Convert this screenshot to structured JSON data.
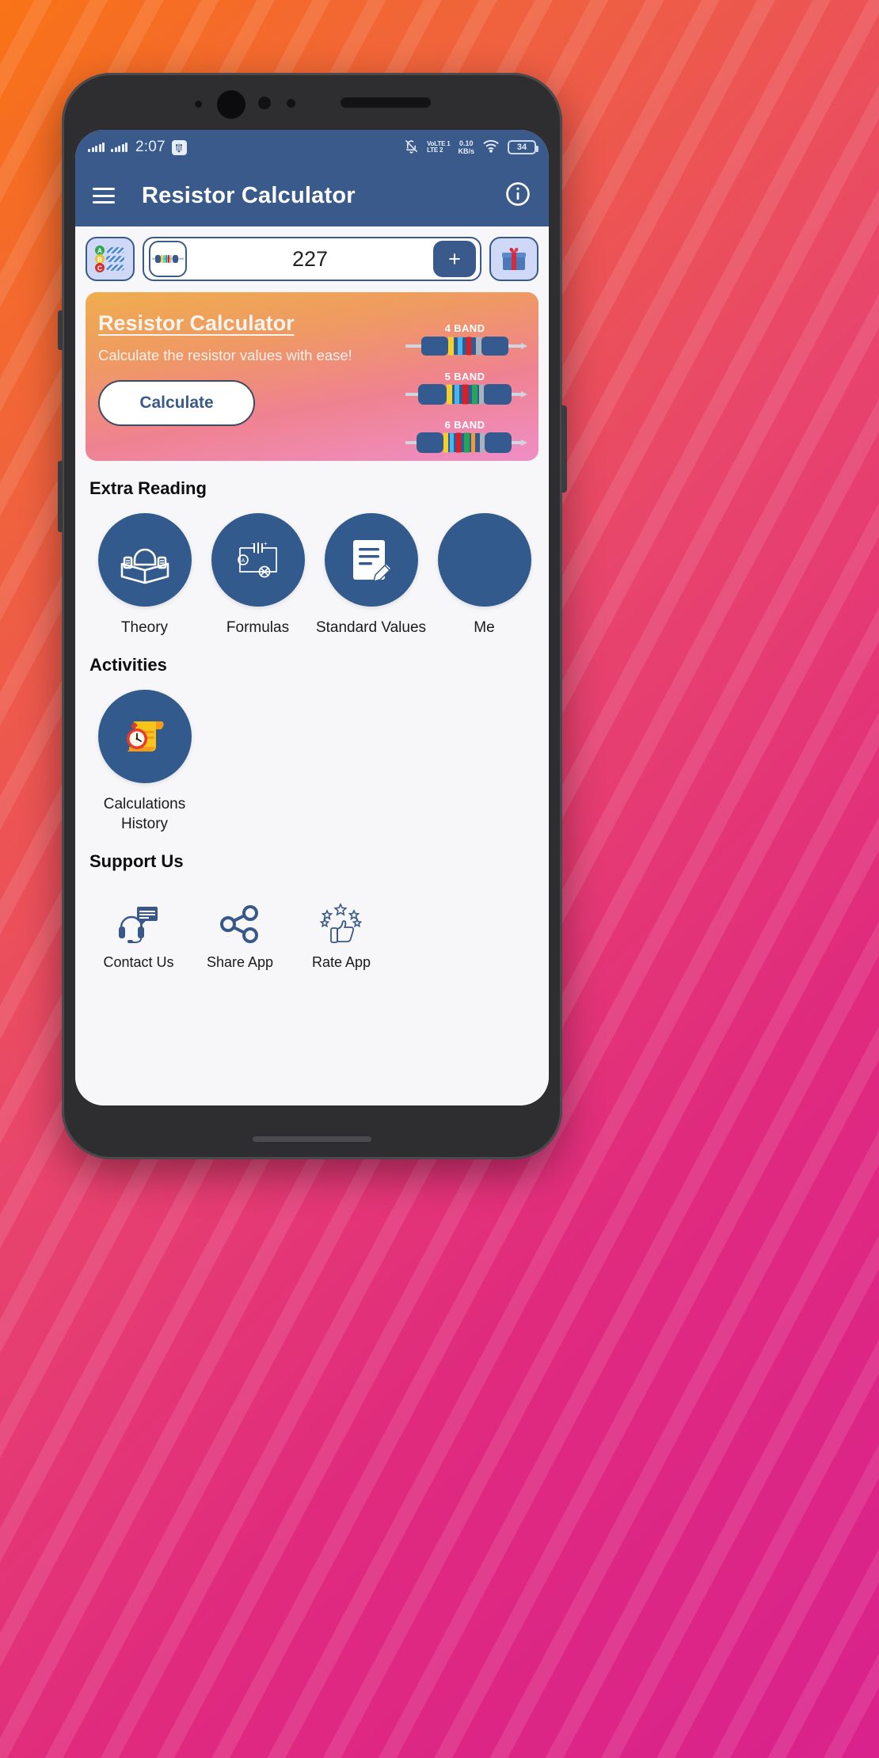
{
  "status_bar": {
    "time": "2:07",
    "signal_icon_1": "signal-bars-icon",
    "signal_icon_2": "signal-bars-icon",
    "usb_debug_icon": "usb-debugging-icon",
    "mute_icon": "bell-mute-icon",
    "volte_line1": "VoLTE 1",
    "volte_line2": "LTE 2",
    "data_rate_value": "0.10",
    "data_rate_unit": "KB/s",
    "wifi_icon": "wifi-icon",
    "battery_level": "34"
  },
  "app_bar": {
    "menu_icon": "hamburger-menu-icon",
    "title": "Resistor Calculator",
    "info_icon": "info-icon"
  },
  "toolbar": {
    "list_button_icon": "abc-list-icon",
    "resistor_icon": "resistor-icon",
    "value": "227",
    "add_label": "+",
    "gift_icon": "gift-box-icon"
  },
  "banner": {
    "title": "Resistor Calculator",
    "subtitle": "Calculate the resistor values with ease!",
    "button_label": "Calculate",
    "resistors": [
      {
        "label": "4 BAND",
        "bands": [
          "#f2d12a",
          "#1d3f73",
          "#45b6f0",
          "#1d3f73",
          "#e01b22",
          "#a9b2bd"
        ]
      },
      {
        "label": "5 BAND",
        "bands": [
          "#f2d12a",
          "#45b6f0",
          "#1d3f73",
          "#e01b22",
          "#1d3f73",
          "#23a55a",
          "#a9b2bd"
        ]
      },
      {
        "label": "6 BAND",
        "bands": [
          "#f2d12a",
          "#45b6f0",
          "#e01b22",
          "#1d3f73",
          "#23a55a",
          "#f09a3c",
          "#1d3f73",
          "#a9b2bd"
        ]
      }
    ]
  },
  "extra_reading": {
    "heading": "Extra Reading",
    "items": [
      {
        "label": "Theory",
        "icon": "open-book-icon"
      },
      {
        "label": "Formulas",
        "icon": "circuit-diagram-icon"
      },
      {
        "label": "Standard Values",
        "icon": "document-pencil-icon"
      },
      {
        "label": "Me",
        "icon": "partial-icon"
      }
    ]
  },
  "activities": {
    "heading": "Activities",
    "items": [
      {
        "label": "Calculations History",
        "icon": "scroll-clock-icon"
      }
    ]
  },
  "support_us": {
    "heading": "Support Us",
    "items": [
      {
        "label": "Contact Us",
        "icon": "headset-chat-icon"
      },
      {
        "label": "Share App",
        "icon": "share-nodes-icon"
      },
      {
        "label": "Rate App",
        "icon": "thumbs-up-stars-icon"
      }
    ]
  },
  "colors": {
    "primary": "#3a5a8c",
    "circle": "#325a8c",
    "accent_light": "#cfd9f7",
    "screen_bg": "#f7f7f9"
  }
}
